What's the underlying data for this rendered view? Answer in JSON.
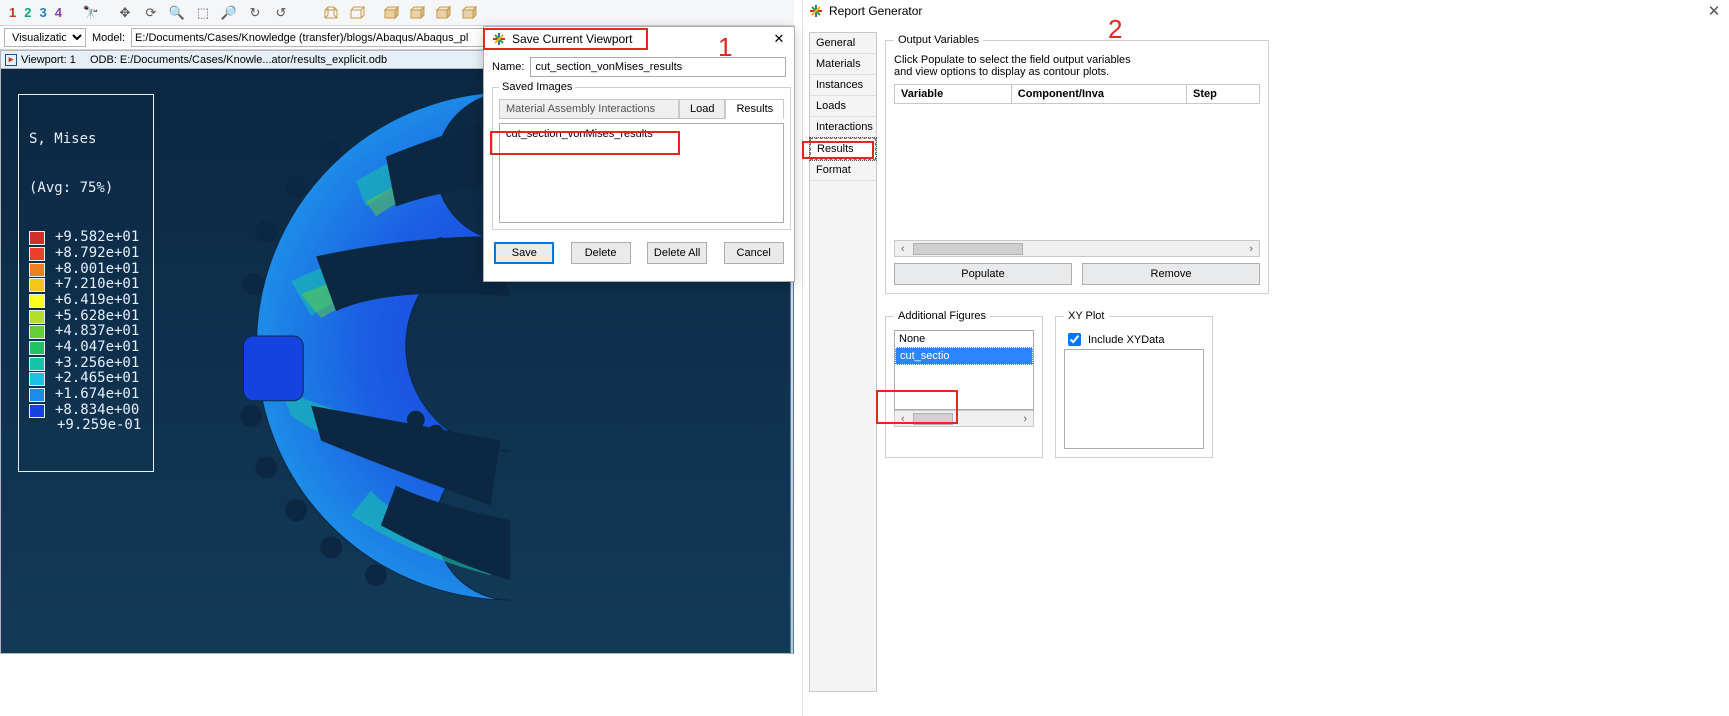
{
  "toolbar": {
    "coord_nums": [
      "1",
      "2",
      "3",
      "4"
    ],
    "visualization_label": "Visualization",
    "model_label": "Model:",
    "model_path": "E:/Documents/Cases/Knowledge (transfer)/blogs/Abaqus/Abaqus_pl"
  },
  "viewport": {
    "title_prefix": "Viewport: 1",
    "title_odb": "ODB: E:/Documents/Cases/Knowle...ator/results_explicit.odb",
    "legend_title": "S, Mises",
    "legend_avg": "(Avg: 75%)",
    "legend_values": [
      "+9.582e+01",
      "+8.792e+01",
      "+8.001e+01",
      "+7.210e+01",
      "+6.419e+01",
      "+5.628e+01",
      "+4.837e+01",
      "+4.047e+01",
      "+3.256e+01",
      "+2.465e+01",
      "+1.674e+01",
      "+8.834e+00",
      "+9.259e-01"
    ],
    "legend_colors": [
      "#d03027",
      "#ec4029",
      "#f07f24",
      "#f8c41c",
      "#ffff1e",
      "#b4de2a",
      "#62cf3a",
      "#1fc364",
      "#18c4a8",
      "#1bc1e3",
      "#1d8be7",
      "#1542e1"
    ]
  },
  "dialog": {
    "title": "Save Current Viewport",
    "name_label": "Name:",
    "name_value": "cut_section_vonMises_results",
    "saved_images_label": "Saved Images",
    "tabs_obscured": "Material   Assembly   Interactions",
    "tab_load": "Load",
    "tab_results": "Results",
    "list_item": "cut_section_vonMises_results",
    "btn_save": "Save",
    "btn_delete": "Delete",
    "btn_delete_all": "Delete All",
    "btn_cancel": "Cancel"
  },
  "annot": {
    "one": "1",
    "two": "2"
  },
  "rg": {
    "title": "Report Generator",
    "tabs": {
      "general": "General",
      "materials": "Materials",
      "instances": "Instances",
      "loads": "Loads",
      "interactions": "Interactions",
      "results": "Results",
      "format": "Format"
    },
    "output_legend": "Output Variables",
    "hint": "Click Populate to select the field output variables and view options to display as contour plots.",
    "th_variable": "Variable",
    "th_component": "Component/Inva",
    "th_step": "Step",
    "btn_populate": "Populate",
    "btn_remove": "Remove",
    "af_legend": "Additional Figures",
    "af_none": "None",
    "af_item": "cut_sectio",
    "xy_legend": "XY Plot",
    "xy_include": "Include XYData"
  }
}
